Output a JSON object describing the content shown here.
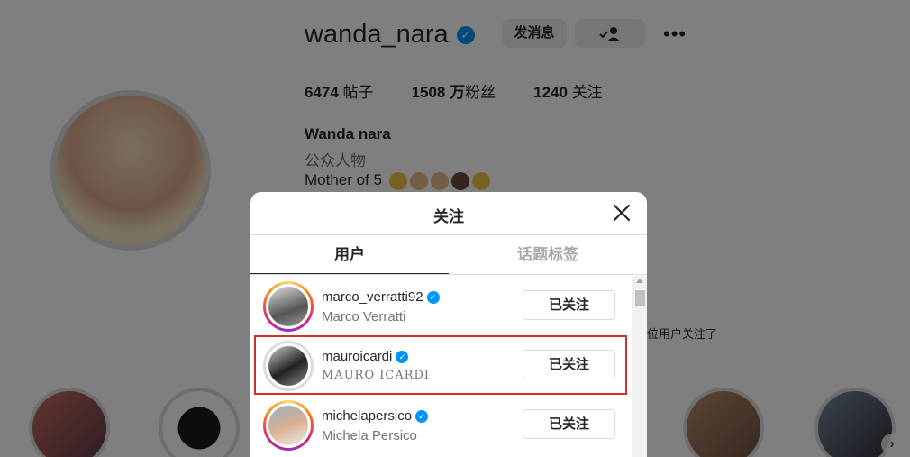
{
  "profile": {
    "username": "wanda_nara",
    "message_button": "发消息",
    "stats": {
      "posts_count": "6474",
      "posts_label": "帖子",
      "followers_count": "1508",
      "followers_unit": "万",
      "followers_label": "粉丝",
      "following_count": "1240",
      "following_label": "关注"
    },
    "full_name": "Wanda nara",
    "category": "公众人物",
    "bio": "Mother of 5",
    "followed_by_text": "位用户关注了"
  },
  "modal": {
    "title": "关注",
    "tabs": [
      {
        "label": "用户",
        "active": true
      },
      {
        "label": "话题标签",
        "active": false
      }
    ],
    "users": [
      {
        "username": "marco_verratti92",
        "name": "Marco Verratti",
        "button": "已关注",
        "story": true
      },
      {
        "username": "mauroicardi",
        "name": "MAURO ICARDI",
        "button": "已关注",
        "story": false,
        "selected": true
      },
      {
        "username": "michelapersico",
        "name": "Michela Persico",
        "button": "已关注",
        "story": true
      }
    ]
  },
  "colors": {
    "verified": "#0095f6",
    "selection_outline": "#d32f2f",
    "overlay": "rgba(0,0,0,0.5)"
  }
}
